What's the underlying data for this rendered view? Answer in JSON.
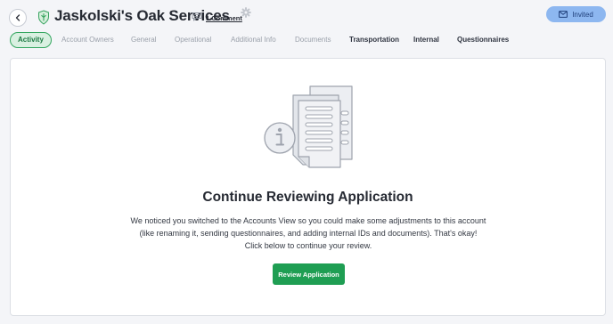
{
  "header": {
    "title": "Jaskolski's Oak Services",
    "comment_link": "1 Comment",
    "status_button": "Invited"
  },
  "tabs": [
    {
      "label": "Activity",
      "state": "active"
    },
    {
      "label": "Account Owners",
      "state": "muted"
    },
    {
      "label": "General",
      "state": "muted"
    },
    {
      "label": "Operational",
      "state": "muted"
    },
    {
      "label": "Additional Info",
      "state": "muted"
    },
    {
      "label": "Documents",
      "state": "muted"
    },
    {
      "label": "Transportation",
      "state": "dark"
    },
    {
      "label": "Internal",
      "state": "dark"
    },
    {
      "label": "Questionnaires",
      "state": "dark"
    }
  ],
  "main": {
    "heading": "Continue Reviewing Application",
    "body": "We noticed you switched to the Accounts View so you could make some adjustments to this account (like renaming it, sending questionnaires, and adding internal IDs and documents). That's okay! Click below to continue your review.",
    "button": "Review Application"
  },
  "colors": {
    "accent_green": "#1f9e53",
    "active_tab_bg": "#d9f0e1",
    "invited_bg": "#8db7f0"
  },
  "icons": [
    "back-arrow-icon",
    "shield-icon",
    "comment-icon",
    "gear-icon",
    "envelope-icon",
    "document-info-icon"
  ]
}
